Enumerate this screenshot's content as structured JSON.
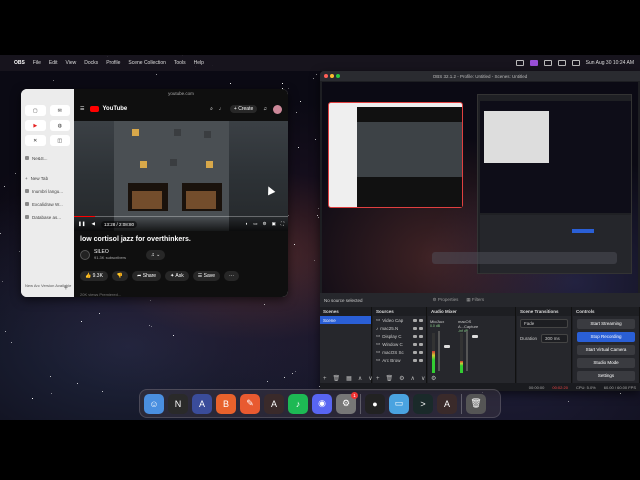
{
  "menubar": {
    "app": "OBS",
    "items": [
      "File",
      "Edit",
      "View",
      "Docks",
      "Profile",
      "Scene Collection",
      "Tools",
      "Help"
    ],
    "clock": "Sun Aug 30  10:24 AM"
  },
  "browser": {
    "url": "youtube.com",
    "sidebar": {
      "tabs": [
        {
          "label": "Ne&S..."
        },
        {
          "label": "New Tab"
        },
        {
          "label": "Inumbri langu..."
        },
        {
          "label": "Excalidraw W..."
        },
        {
          "label": "Database as..."
        }
      ],
      "footer": "New Arc Version Available"
    },
    "youtube": {
      "logo": "YouTube",
      "create_label": "Create",
      "time": "13:28 / 2:08:80",
      "progress": 0.1,
      "title": "low cortisol jazz for overthinkers.",
      "channel": "SILEO",
      "subscribers": "91.3K subscribers",
      "actions": {
        "like": "9.3K",
        "share": "Share",
        "ask": "Ask",
        "save": "Save",
        "more": "···"
      },
      "below": "20K views  Premiered..."
    }
  },
  "obs": {
    "title": "OBS 32.1.2 - Profile: Untitled - Scenes: Untitled",
    "no_source": "No source selected",
    "scene_tabs": {
      "properties": "Properties",
      "filters": "Filters"
    },
    "docks": {
      "scenes": {
        "title": "Scenes",
        "items": [
          "Scene"
        ]
      },
      "sources": {
        "title": "Sources",
        "items": [
          "Video Cap",
          "mac25.N",
          "Display C",
          "Window C",
          "macOS Sc",
          "Arc Brow"
        ]
      },
      "mixer": {
        "title": "Audio Mixer",
        "channels": [
          {
            "label": "Mic/Aux",
            "db": "0.0 dB",
            "level": 0.55
          },
          {
            "label": "macOS A...Capture",
            "db": "-inf dB",
            "level": 0.3
          }
        ]
      },
      "transitions": {
        "title": "Scene Transitions",
        "type": "Fade",
        "duration_label": "Duration",
        "duration": "300 ms"
      },
      "controls": {
        "title": "Controls",
        "buttons": [
          "Start Streaming",
          "Stop Recording",
          "Start Virtual Camera",
          "Studio Mode",
          "Settings"
        ]
      }
    },
    "status": {
      "rec": "00:02:20",
      "cpu": "CPU: 5.0%",
      "fps": "60.00 / 60.00 FPS",
      "time": "00:00:00"
    }
  },
  "dock": {
    "apps": [
      {
        "name": "Finder",
        "glyph": "☺",
        "color": "#4a8fe0"
      },
      {
        "name": "Notion",
        "glyph": "N",
        "color": "#2a2a2a"
      },
      {
        "name": "Affinity",
        "glyph": "A",
        "color": "#3a4c9a"
      },
      {
        "name": "Brave",
        "glyph": "B",
        "color": "#e8622c"
      },
      {
        "name": "Pen",
        "glyph": "✎",
        "color": "#e85a30"
      },
      {
        "name": "Arc",
        "glyph": "A",
        "color": "#3a2a2a"
      },
      {
        "name": "Spotify",
        "glyph": "♪",
        "color": "#1db954"
      },
      {
        "name": "Discord",
        "glyph": "◉",
        "color": "#5865f2"
      },
      {
        "name": "Settings",
        "glyph": "⚙",
        "color": "#777",
        "badge": "1"
      },
      {
        "name": "OBS",
        "glyph": "●",
        "color": "#222"
      },
      {
        "name": "Folder",
        "glyph": "▭",
        "color": "#4aa3e0"
      },
      {
        "name": "Terminal",
        "glyph": ">",
        "color": "#1a2a2a"
      },
      {
        "name": "Arc",
        "glyph": "A",
        "color": "#3a2a2a"
      },
      {
        "name": "Trash",
        "glyph": "🗑",
        "color": "#555"
      }
    ]
  }
}
